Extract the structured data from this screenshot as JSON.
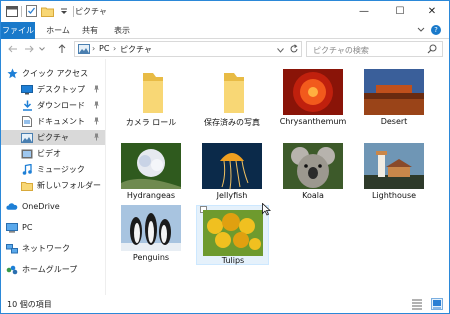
{
  "window": {
    "title": "ピクチャ",
    "buttons": {
      "minimize": "—",
      "maximize": "☐",
      "close": "✕"
    }
  },
  "ribbon": {
    "tabs": [
      "ファイル",
      "ホーム",
      "共有",
      "表示"
    ],
    "help_label": "?"
  },
  "nav": {
    "breadcrumb": [
      "PC",
      "ピクチャ"
    ],
    "search_placeholder": "ピクチャの検索"
  },
  "sidebar": {
    "items": [
      {
        "label": "クイック アクセス",
        "icon": "star-icon",
        "pinned": false
      },
      {
        "label": "デスクトップ",
        "icon": "desktop-icon",
        "pinned": true
      },
      {
        "label": "ダウンロード",
        "icon": "download-icon",
        "pinned": true
      },
      {
        "label": "ドキュメント",
        "icon": "documents-icon",
        "pinned": true
      },
      {
        "label": "ピクチャ",
        "icon": "pictures-icon",
        "pinned": true,
        "selected": true
      },
      {
        "label": "ビデオ",
        "icon": "video-icon",
        "pinned": false
      },
      {
        "label": "ミュージック",
        "icon": "music-icon",
        "pinned": false
      },
      {
        "label": "新しいフォルダー",
        "icon": "folder-icon",
        "pinned": false
      },
      {
        "label": "OneDrive",
        "icon": "onedrive-icon",
        "pinned": false
      },
      {
        "label": "PC",
        "icon": "pc-icon",
        "pinned": false
      },
      {
        "label": "ネットワーク",
        "icon": "network-icon",
        "pinned": false
      },
      {
        "label": "ホームグループ",
        "icon": "homegroup-icon",
        "pinned": false
      }
    ]
  },
  "items": [
    {
      "label": "カメラ ロール",
      "kind": "folder"
    },
    {
      "label": "保存済みの写真",
      "kind": "folder"
    },
    {
      "label": "Chrysanthemum",
      "kind": "image",
      "colors": [
        "#c0200d",
        "#f25a1c",
        "#8a1408"
      ]
    },
    {
      "label": "Desert",
      "kind": "image",
      "colors": [
        "#3a5f9a",
        "#c0501c",
        "#6a2b10"
      ]
    },
    {
      "label": "Hydrangeas",
      "kind": "image",
      "colors": [
        "#2f5a1e",
        "#e6e9f0",
        "#6f8a50"
      ]
    },
    {
      "label": "Jellyfish",
      "kind": "image",
      "colors": [
        "#0b2a4a",
        "#f0a020",
        "#2a4f7a"
      ]
    },
    {
      "label": "Koala",
      "kind": "image",
      "colors": [
        "#3d5a2a",
        "#b7b3ad",
        "#5e5a52"
      ]
    },
    {
      "label": "Lighthouse",
      "kind": "image",
      "colors": [
        "#6f96b5",
        "#c9874a",
        "#2e3a2a"
      ]
    },
    {
      "label": "Penguins",
      "kind": "image",
      "colors": [
        "#a8c4e0",
        "#1b1b1b",
        "#e8eef4"
      ]
    },
    {
      "label": "Tulips",
      "kind": "image",
      "colors": [
        "#6e9a2e",
        "#f0c020",
        "#e0a010"
      ],
      "selected": true
    }
  ],
  "status": {
    "count": "10 個の項目"
  },
  "colors": {
    "accent": "#1979ca",
    "folder": "#f8d775",
    "folder_dark": "#e8bb45",
    "selection": "#e5f1fb"
  }
}
